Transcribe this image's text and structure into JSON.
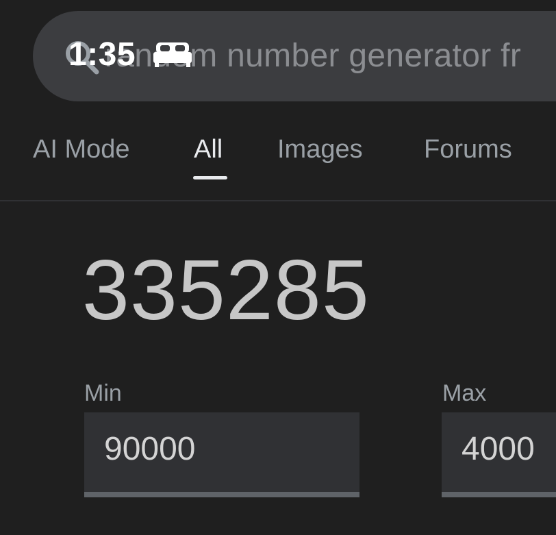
{
  "status_bar": {
    "time": "1:35",
    "sleep_icon": "bed-icon"
  },
  "search": {
    "query": "random number generator fr",
    "icon": "search-icon"
  },
  "tabs": [
    {
      "label": "AI Mode",
      "active": false
    },
    {
      "label": "All",
      "active": true
    },
    {
      "label": "Images",
      "active": false
    },
    {
      "label": "Forums",
      "active": false
    }
  ],
  "generator": {
    "result": "335285",
    "min_label": "Min",
    "min_value": "90000",
    "max_label": "Max",
    "max_value": "4000"
  },
  "colors": {
    "background": "#1f1f1f",
    "search_bar": "#3c3d40",
    "field_background": "#303134",
    "field_underline": "#5f6368",
    "active_tab": "#e8eaed",
    "inactive_tab": "#9aa0a6"
  }
}
